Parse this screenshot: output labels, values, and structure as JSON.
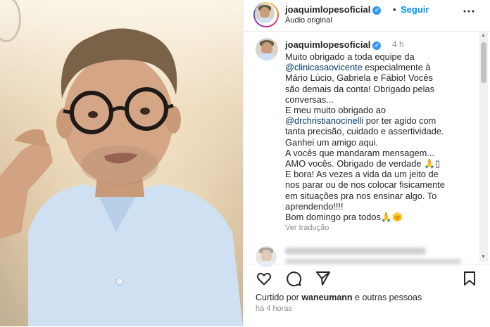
{
  "header": {
    "username": "joaquimlopesoficial",
    "separator": "•",
    "follow_label": "Seguir",
    "audio_label": "Áudio original",
    "more_icon": "more-horizontal-icon"
  },
  "caption": {
    "username": "joaquimlopesoficial",
    "time_ago": "4 h",
    "lines": [
      {
        "pre": "Muito obrigado a toda equipe da",
        "mention": "",
        "post": ""
      },
      {
        "pre": "",
        "mention": "@clinicasaovicente",
        "post": " especialmente à"
      },
      {
        "pre": "Mário Lúcio, Gabriela e Fábio! Vocês",
        "mention": "",
        "post": ""
      },
      {
        "pre": "são demais da conta! Obrigado pelas",
        "mention": "",
        "post": ""
      },
      {
        "pre": "conversas...",
        "mention": "",
        "post": ""
      },
      {
        "pre": "E meu muito obrigado ao",
        "mention": "",
        "post": ""
      },
      {
        "pre": "",
        "mention": "@drchristianocinelli",
        "post": " por ter agido com"
      },
      {
        "pre": "tanta precisão, cuidado e assertividade.",
        "mention": "",
        "post": ""
      },
      {
        "pre": "Ganhei um amigo aqui.",
        "mention": "",
        "post": ""
      },
      {
        "pre": "A vocês que mandaram mensagem...",
        "mention": "",
        "post": ""
      },
      {
        "pre": "AMO vocês. Obrigado de verdade 🙏▯",
        "mention": "",
        "post": ""
      },
      {
        "pre": "E bora! As vezes a vida da um jeito de",
        "mention": "",
        "post": ""
      },
      {
        "pre": "nos parar ou de nos colocar fisicamente",
        "mention": "",
        "post": ""
      },
      {
        "pre": "em situações pra nos ensinar algo. To",
        "mention": "",
        "post": ""
      },
      {
        "pre": "aprendendo!!!!",
        "mention": "",
        "post": ""
      },
      {
        "pre": "Bom domingo pra todos🙏🌞",
        "mention": "",
        "post": ""
      }
    ],
    "translate_label": "Ver tradução"
  },
  "footer": {
    "liked_prefix": "Curtido por ",
    "liked_user": "waneumann",
    "liked_suffix": " e outras pessoas",
    "time_ago": "há 4 horas"
  },
  "colors": {
    "accent": "#0095f6",
    "mention": "#00376b",
    "muted": "#8e8e8e",
    "verified": "#3897f0"
  }
}
